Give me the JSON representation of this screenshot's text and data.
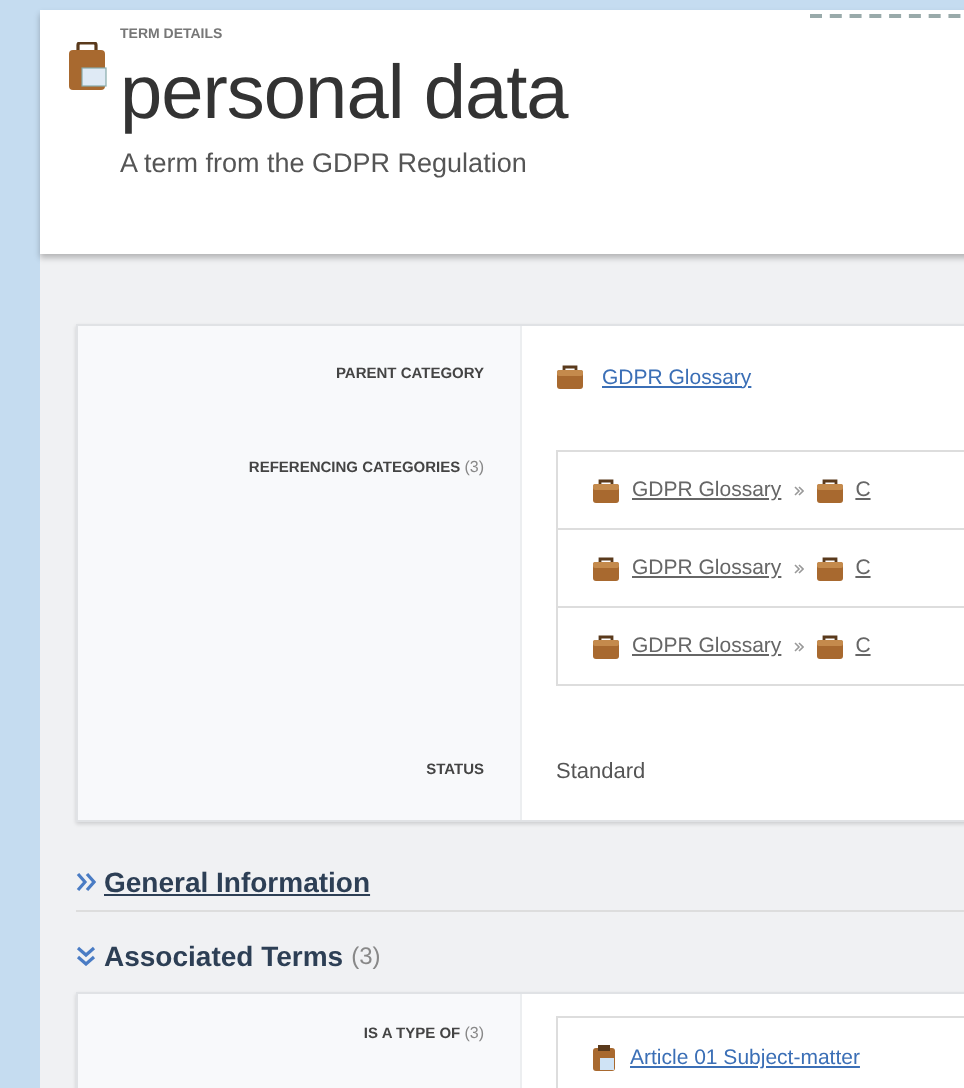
{
  "header": {
    "eyebrow": "TERM DETAILS",
    "title": "personal data",
    "subtitle": "A term from the GDPR Regulation"
  },
  "details": [
    {
      "kind": "link",
      "label": "PARENT CATEGORY",
      "value": "GDPR Glossary"
    },
    {
      "kind": "paths",
      "label": "REFERENCING CATEGORIES",
      "count": "(3)",
      "paths": [
        [
          "GDPR Glossary",
          "C"
        ],
        [
          "GDPR Glossary",
          "C"
        ],
        [
          "GDPR Glossary",
          "C"
        ]
      ]
    },
    {
      "kind": "text",
      "label": "STATUS",
      "value": "Standard"
    }
  ],
  "sections": [
    {
      "title": "General Information",
      "expanded": false
    },
    {
      "title": "Associated Terms",
      "count": "(3)",
      "expanded": true,
      "rows": [
        {
          "label": "IS A TYPE OF",
          "count": "(3)",
          "items": [
            "Article 01 Subject-matter"
          ]
        }
      ]
    }
  ]
}
